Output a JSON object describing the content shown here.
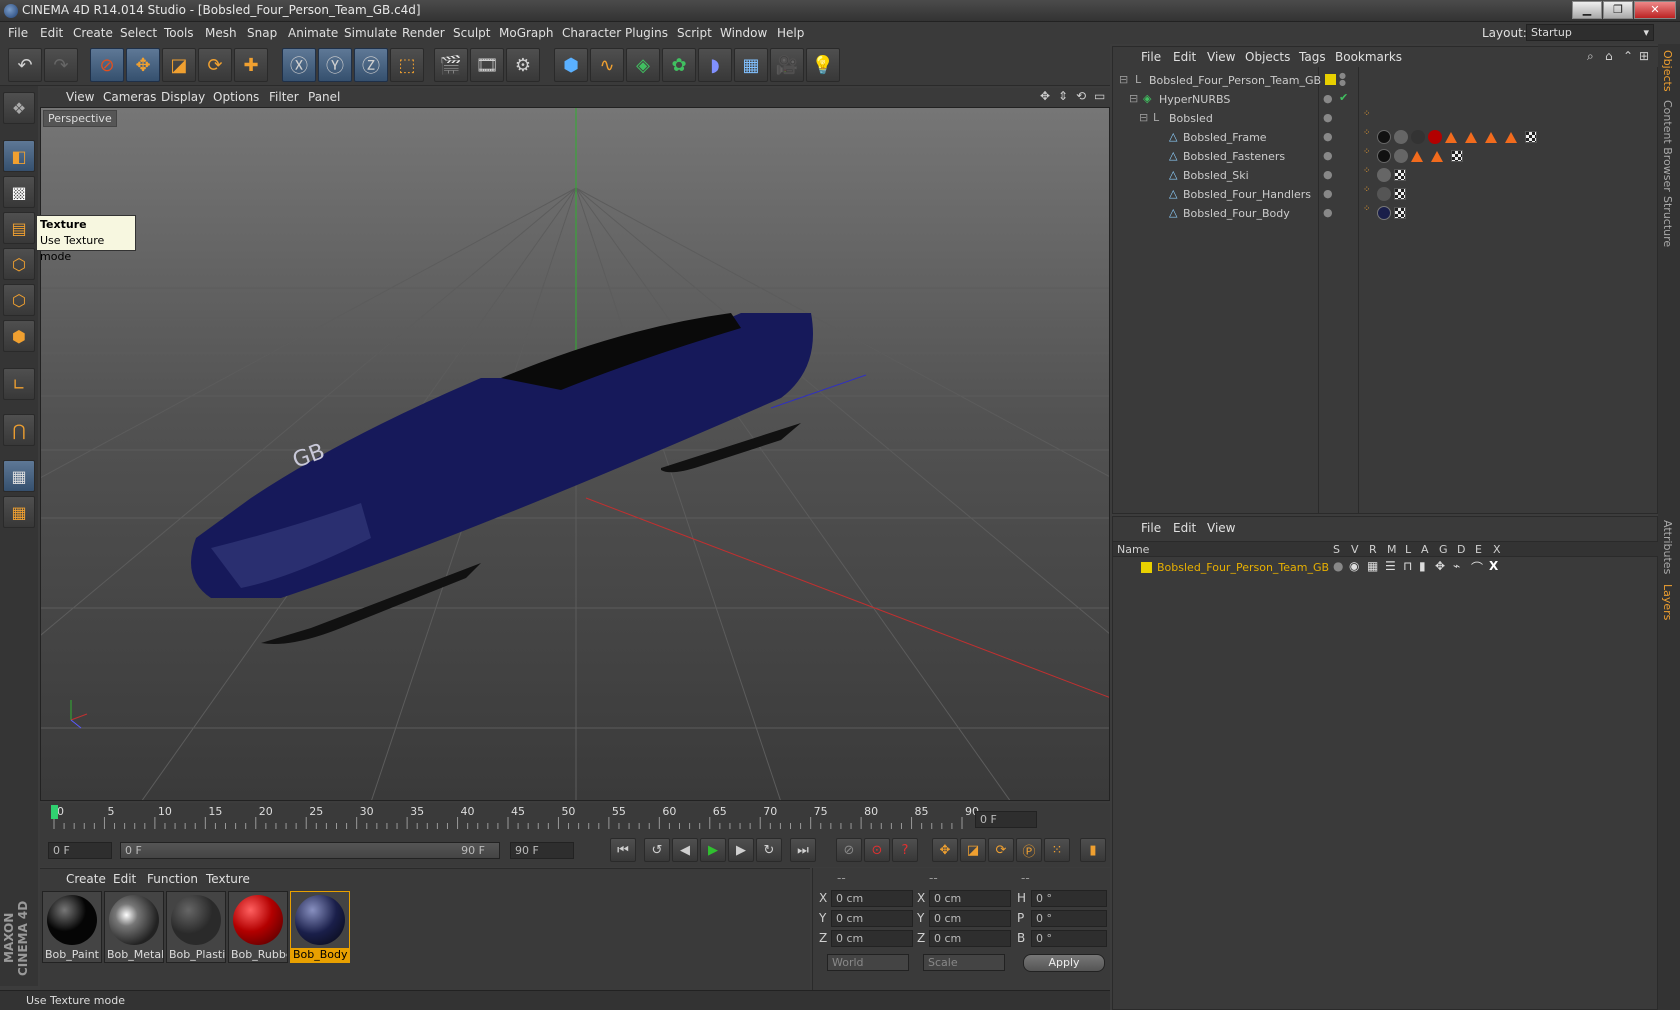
{
  "app": {
    "title": "CINEMA 4D R14.014 Studio - [Bobsled_Four_Person_Team_GB.c4d]",
    "layout_label": "Layout:",
    "layout_value": "Startup"
  },
  "menu": [
    "File",
    "Edit",
    "Create",
    "Select",
    "Tools",
    "Mesh",
    "Snap",
    "Animate",
    "Simulate",
    "Render",
    "Sculpt",
    "MoGraph",
    "Character",
    "Plugins",
    "Script",
    "Window",
    "Help"
  ],
  "viewport": {
    "menu": [
      "View",
      "Cameras",
      "Display",
      "Options",
      "Filter",
      "Panel"
    ],
    "label": "Perspective",
    "tooltip_title": "Texture",
    "tooltip_text": "Use Texture mode"
  },
  "timeline": {
    "ticks": [
      "0",
      "5",
      "10",
      "15",
      "20",
      "25",
      "30",
      "35",
      "40",
      "45",
      "50",
      "55",
      "60",
      "65",
      "70",
      "75",
      "80",
      "85",
      "90"
    ],
    "current": "0 F",
    "start": "0 F",
    "range_start": "0 F",
    "range_end": "90 F",
    "end": "90 F",
    "progress": 0
  },
  "materials": {
    "menu": [
      "Create",
      "Edit",
      "Function",
      "Texture"
    ],
    "items": [
      {
        "name": "Bob_Paint",
        "color": "#050505"
      },
      {
        "name": "Bob_Metal",
        "color": "#777777"
      },
      {
        "name": "Bob_Plastic",
        "color": "#2a2a2a"
      },
      {
        "name": "Bob_Rubber",
        "color": "#b30000"
      },
      {
        "name": "Bob_Body",
        "color": "#1a1f4a"
      }
    ]
  },
  "coords": {
    "headers": [
      "--",
      "--",
      "--"
    ],
    "rows": [
      {
        "a": "X",
        "av": "0 cm",
        "b": "X",
        "bv": "0 cm",
        "c": "H",
        "cv": "0 °"
      },
      {
        "a": "Y",
        "av": "0 cm",
        "b": "Y",
        "bv": "0 cm",
        "c": "P",
        "cv": "0 °"
      },
      {
        "a": "Z",
        "av": "0 cm",
        "b": "Z",
        "bv": "0 cm",
        "c": "B",
        "cv": "0 °"
      }
    ],
    "space": "World",
    "mode": "Scale",
    "apply": "Apply"
  },
  "status": "Use Texture mode",
  "objects": {
    "menu": [
      "File",
      "Edit",
      "View",
      "Objects",
      "Tags",
      "Bookmarks"
    ],
    "tree": [
      {
        "name": "Bobsled_Four_Person_Team_GB",
        "indent": 0
      },
      {
        "name": "HyperNURBS",
        "indent": 1
      },
      {
        "name": "Bobsled",
        "indent": 2
      },
      {
        "name": "Bobsled_Frame",
        "indent": 3
      },
      {
        "name": "Bobsled_Fasteners",
        "indent": 3
      },
      {
        "name": "Bobsled_Ski",
        "indent": 3
      },
      {
        "name": "Bobsled_Four_Handlers",
        "indent": 3
      },
      {
        "name": "Bobsled_Four_Body",
        "indent": 3
      }
    ]
  },
  "layers": {
    "menu": [
      "File",
      "Edit",
      "View"
    ],
    "cols": [
      "Name",
      "S",
      "V",
      "R",
      "M",
      "L",
      "A",
      "G",
      "D",
      "E",
      "X"
    ],
    "row": "Bobsled_Four_Person_Team_GB"
  },
  "right_tabs": [
    "Objects",
    "Content Browser",
    "Structure",
    "Attributes",
    "Layers"
  ],
  "brand": "MAXON CINEMA 4D",
  "colors": {
    "accent": "#f0a030",
    "selected_layer": "#e8b000",
    "axis_x": "#c03030",
    "axis_y": "#30b030"
  }
}
